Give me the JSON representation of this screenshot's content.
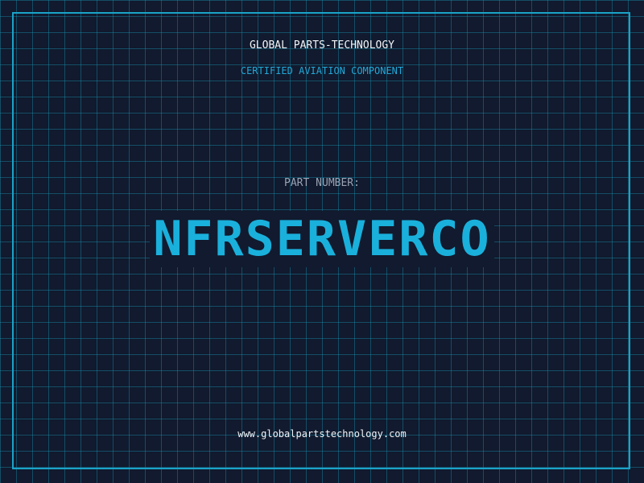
{
  "header": {
    "company": "GLOBAL PARTS-TECHNOLOGY",
    "subtitle": "CERTIFIED AVIATION COMPONENT"
  },
  "part": {
    "label": "PART NUMBER:",
    "number": "NFRSERVERCO"
  },
  "footer": {
    "website": "www.globalpartstechnology.com"
  },
  "colors": {
    "background": "#111a2e",
    "grid": "#188caa",
    "accent": "#1ab0dc",
    "text": "#f2f4f7",
    "muted": "#9aa4b5"
  }
}
